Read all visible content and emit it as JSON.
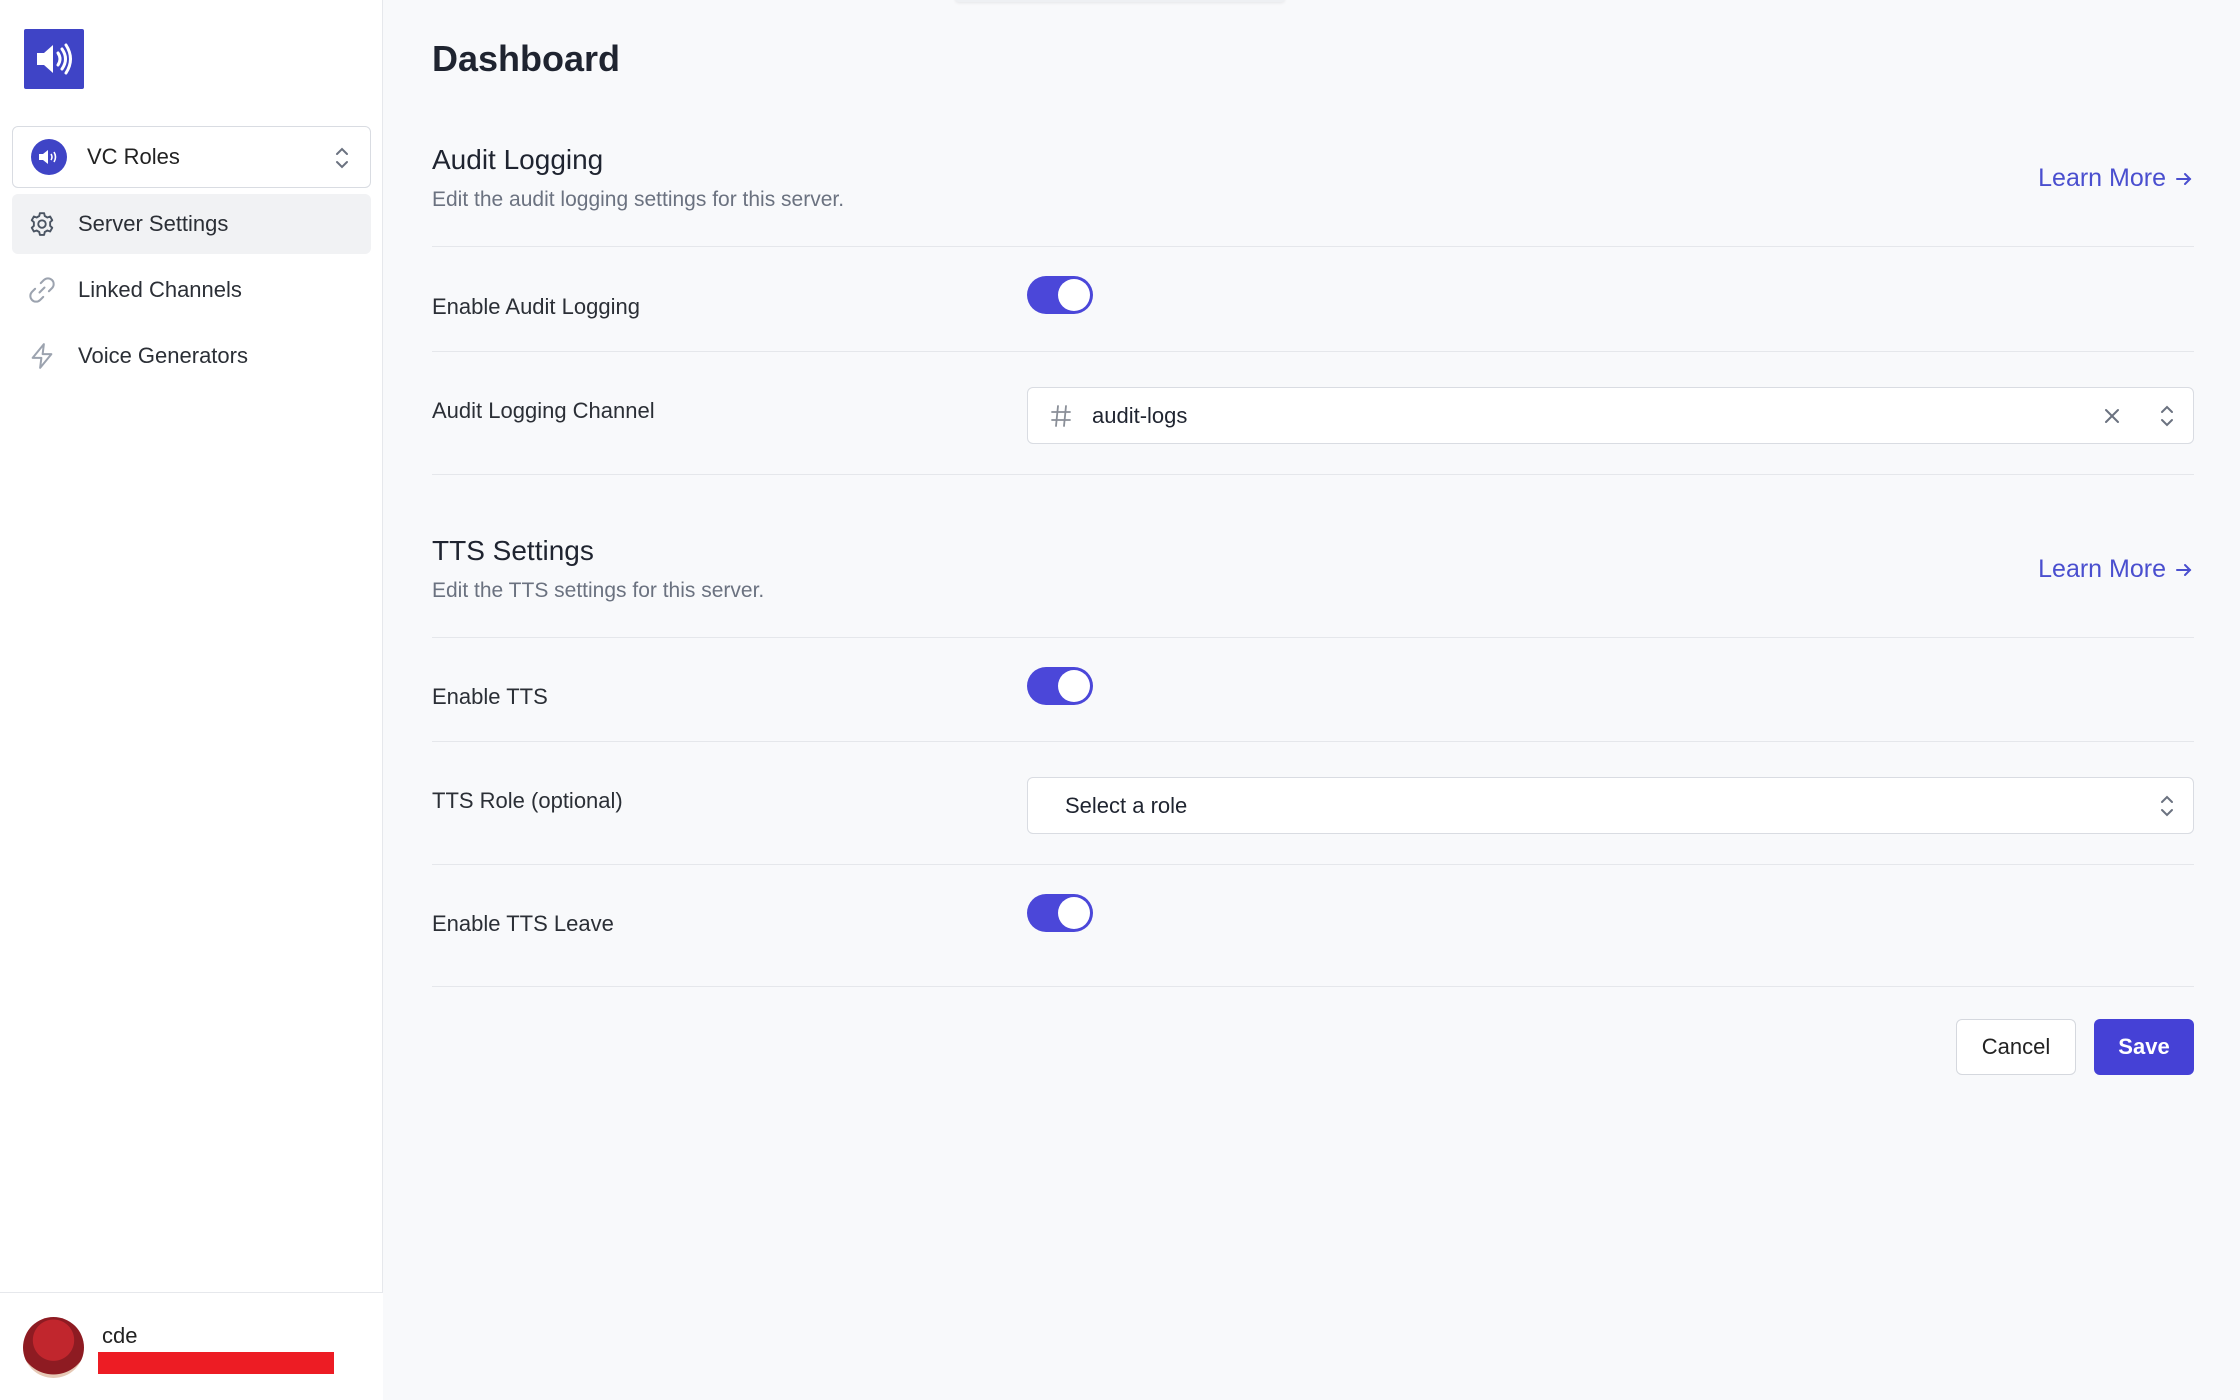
{
  "sidebar": {
    "logo_icon": "speaker-icon",
    "server_selector": {
      "name": "VC Roles",
      "icon": "speaker-avatar-icon"
    },
    "nav": [
      {
        "label": "Server Settings",
        "icon": "gear-icon",
        "active": true
      },
      {
        "label": "Linked Channels",
        "icon": "link-icon",
        "active": false
      },
      {
        "label": "Voice Generators",
        "icon": "bolt-icon",
        "active": false
      }
    ],
    "user": {
      "name": "cde"
    }
  },
  "page": {
    "title": "Dashboard"
  },
  "audit_logging": {
    "title": "Audit Logging",
    "description": "Edit the audit logging settings for this server.",
    "learn_more": "Learn More",
    "enable_label": "Enable Audit Logging",
    "enable_value": true,
    "channel_label": "Audit Logging Channel",
    "channel_value": "audit-logs"
  },
  "tts": {
    "title": "TTS Settings",
    "description": "Edit the TTS settings for this server.",
    "learn_more": "Learn More",
    "enable_label": "Enable TTS",
    "enable_value": true,
    "role_label": "TTS Role (optional)",
    "role_placeholder": "Select a role",
    "leave_label": "Enable TTS Leave",
    "leave_value": true
  },
  "actions": {
    "cancel": "Cancel",
    "save": "Save"
  },
  "colors": {
    "accent": "#4541d6",
    "logo_bg": "#3f44c6",
    "link": "#4a4fcf",
    "redaction": "#ed1c24"
  }
}
